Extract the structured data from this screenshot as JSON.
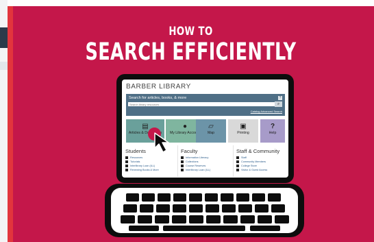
{
  "headline": {
    "line1": "HOW TO",
    "line2": "SEARCH EFFICIENTLY"
  },
  "library_page": {
    "title": "BARBER LIBRARY",
    "search": {
      "prompt": "Search for articles, books, & more",
      "placeholder": "Search library resources",
      "advanced_link": "Catalog Advanced Search"
    },
    "tiles": [
      {
        "label": "Articles & Databases",
        "icon": "document-icon",
        "color": "#6aa09b"
      },
      {
        "label": "My Library Account",
        "icon": "person-icon",
        "color": "#7fb59f"
      },
      {
        "label": "Map",
        "icon": "map-icon",
        "color": "#6c94a8"
      },
      {
        "label": "Printing",
        "icon": "printer-icon",
        "color": "#d9d9d9"
      },
      {
        "label": "Help",
        "icon": "question-icon",
        "color": "#a79bc9"
      }
    ],
    "columns": [
      {
        "heading": "Students",
        "items": [
          "Resources",
          "Tutorials",
          "Interlibrary Loan (ILL)",
          "Renewing Books & More"
        ]
      },
      {
        "heading": "Faculty",
        "items": [
          "Information Literacy",
          "Collections",
          "Course Reserves",
          "Interlibrary Loan (ILL)"
        ]
      },
      {
        "heading": "Staff & Community",
        "items": [
          "Staff",
          "Community Members",
          "College Store",
          "Visitor & Guest Access"
        ]
      }
    ]
  },
  "colors": {
    "background": "#c4174a",
    "accent_stripe": "#e2353d",
    "device": "#0d0d0d"
  }
}
